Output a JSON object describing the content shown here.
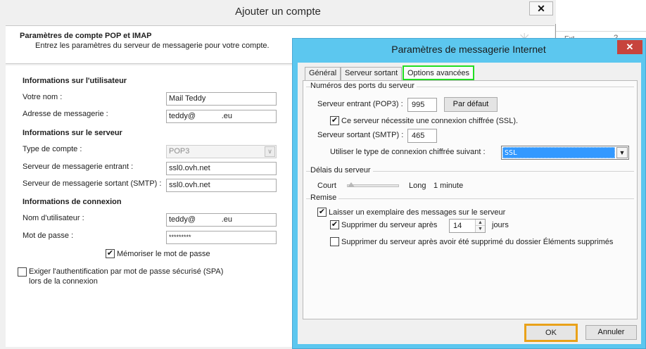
{
  "background_window": {
    "fragments": [
      "Ext",
      "?"
    ]
  },
  "main_dialog": {
    "title": "Ajouter un compte",
    "close_glyph": "✕",
    "header": {
      "title": "Paramètres de compte POP et IMAP",
      "subtitle": "Entrez les paramètres du serveur de messagerie pour votre compte."
    },
    "user_info": {
      "heading": "Informations sur l'utilisateur",
      "name_label": "Votre nom :",
      "name_value": "Mail Teddy",
      "email_label": "Adresse de messagerie :",
      "email_value": "teddy@            .eu"
    },
    "server_info": {
      "heading": "Informations sur le serveur",
      "account_type_label": "Type de compte :",
      "account_type_value": "POP3",
      "incoming_label": "Serveur de messagerie entrant :",
      "incoming_value": "ssl0.ovh.net",
      "outgoing_label": "Serveur de messagerie sortant (SMTP) :",
      "outgoing_value": "ssl0.ovh.net"
    },
    "login_info": {
      "heading": "Informations de connexion",
      "username_label": "Nom d'utilisateur :",
      "username_value": "teddy@            .eu",
      "password_label": "Mot de passe :",
      "password_value": "*********",
      "remember_label": "Mémoriser le mot de passe",
      "remember_checked": true,
      "spa_label_line1": "Exiger l'authentification par mot de passe sécurisé (SPA)",
      "spa_label_line2": "lors de la connexion",
      "spa_checked": false
    }
  },
  "internet_settings": {
    "title": "Paramètres de messagerie Internet",
    "close_glyph": "✕",
    "tabs": [
      {
        "label": "Général",
        "active": false
      },
      {
        "label": "Serveur sortant",
        "active": false
      },
      {
        "label": "Options avancées",
        "active": true
      }
    ],
    "ports": {
      "group_title": "Numéros des ports du serveur",
      "incoming_label": "Serveur entrant (POP3) :",
      "incoming_port": "995",
      "default_button": "Par défaut",
      "ssl_label": "Ce serveur nécessite une connexion chiffrée (SSL).",
      "ssl_checked": true,
      "outgoing_label": "Serveur sortant (SMTP) :",
      "outgoing_port": "465",
      "encryption_label": "Utiliser le type de connexion chiffrée suivant :",
      "encryption_value": "SSL",
      "arrow_glyph": "▼"
    },
    "timeout": {
      "group_title": "Délais du serveur",
      "short_label": "Court",
      "long_label": "Long",
      "value_label": "1 minute",
      "level": 0.0
    },
    "delivery": {
      "group_title": "Remise",
      "leave_copy_label": "Laisser un exemplaire des messages sur le serveur",
      "leave_copy_checked": true,
      "remove_after_label": "Supprimer du serveur après",
      "remove_after_checked": true,
      "remove_after_days": "14",
      "days_label": "jours",
      "remove_deleted_label": "Supprimer du serveur après avoir été supprimé du dossier Éléments supprimés",
      "remove_deleted_checked": false
    },
    "buttons": {
      "ok": "OK",
      "cancel": "Annuler"
    },
    "colors": {
      "titlebar": "#5cc7ef",
      "close": "#c7443d",
      "active_tab_highlight": "#22dd22",
      "ok_highlight": "#e9a21a",
      "selection": "#3399ff"
    }
  }
}
